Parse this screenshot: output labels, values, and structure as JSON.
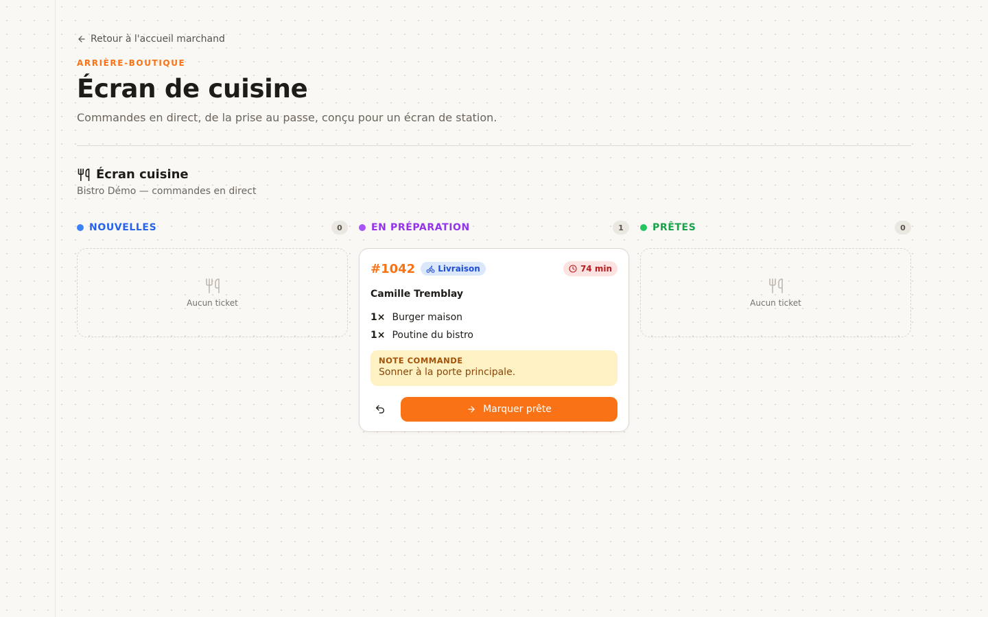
{
  "nav": {
    "back_label": "Retour à l'accueil marchand",
    "back_icon": "arrow-left-icon"
  },
  "header": {
    "eyebrow": "ARRIÈRE-BOUTIQUE",
    "title": "Écran de cuisine",
    "subtitle": "Commandes en direct, de la prise au passe, conçu pour un écran de station."
  },
  "section": {
    "icon": "utensils-icon",
    "title": "Écran cuisine",
    "subtitle": "Bistro Démo — commandes en direct"
  },
  "columns": [
    {
      "name": "NOUVELLES",
      "count": "0",
      "color": "#2563eb",
      "dot_color": "#3b82f6",
      "empty_text": "Aucun ticket"
    },
    {
      "name": "EN PRÉPARATION",
      "count": "1",
      "color": "#9333ea",
      "dot_color": "#a855f7"
    },
    {
      "name": "PRÊTES",
      "count": "0",
      "color": "#16a34a",
      "dot_color": "#22c55e",
      "empty_text": "Aucun ticket"
    }
  ],
  "ticket": {
    "order_number": "#1042",
    "type_label": "Livraison",
    "type_icon": "bike-icon",
    "elapsed": "74 min",
    "timer_icon": "clock-icon",
    "customer": "Camille Tremblay",
    "items": [
      {
        "qty": "1×",
        "name": "Burger maison"
      },
      {
        "qty": "1×",
        "name": "Poutine du bistro"
      }
    ],
    "note_label": "NOTE COMMANDE",
    "note_text": "Sonner à la porte principale.",
    "undo_icon": "undo-icon",
    "action_label": "Marquer prête",
    "action_icon": "arrow-right-icon"
  },
  "colors": {
    "accent": "#f97316",
    "background": "#f9f8f5"
  }
}
